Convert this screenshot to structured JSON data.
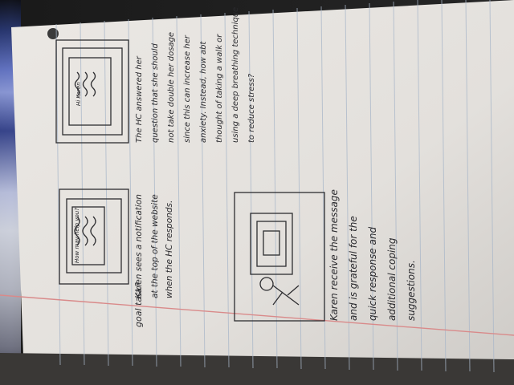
{
  "notes": {
    "top_left_margin": "goal task?",
    "frame1_screen_text": "How may help you?",
    "frame1_caption_lines": [
      "Karen sees a notification",
      "at the top of the website",
      "when the HC responds."
    ],
    "frame2_screen_text": "Hi Karen",
    "frame2_caption_lines": [
      "The HC answered her",
      "question that she should",
      "not take double her dosage",
      "since this can increase her",
      "anxiety. Instead, how abt",
      "thought of taking a walk or",
      "using a deep breathing technique",
      "to reduce stress?"
    ],
    "frame3_caption_lines": [
      "Karen receive the message",
      "and is grateful for the",
      "quick response and",
      "additional coping",
      "suggestions."
    ]
  },
  "colors": {
    "paper": "#e6e3df",
    "paper_shadow": "#cfccc8",
    "rule_line": "#9fb0c6",
    "margin_line": "#d78a8a",
    "ink": "#2a2a2e"
  }
}
